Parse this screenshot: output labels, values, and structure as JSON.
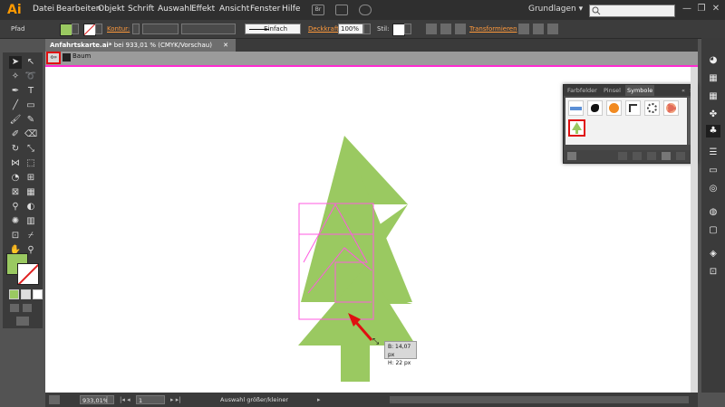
{
  "app": {
    "logo": "Ai"
  },
  "menu": [
    "Datei",
    "Bearbeiten",
    "Objekt",
    "Schrift",
    "Auswahl",
    "Effekt",
    "Ansicht",
    "Fenster",
    "Hilfe"
  ],
  "menubar": {
    "br_label": "Br",
    "workspace": "Grundlagen",
    "workspace_arrow": "▾",
    "search_icon": "search-icon"
  },
  "window_controls": {
    "minimize": "—",
    "restore": "❐",
    "close": "✕"
  },
  "control_bar": {
    "selection_type": "Pfad",
    "fill_color": "#9ac961",
    "stroke_label": "Kontur:",
    "stroke_style": "Einfach",
    "opacity_label": "Deckkraft",
    "opacity_value": "100%",
    "style_label": "Stil:",
    "transform_label": "Transformieren"
  },
  "document": {
    "tab_name": "Anfahrtskarte.ai*",
    "tab_info": "bei 933,01 % (CMYK/Vorschau)",
    "tab_close": "✕",
    "isolation_label": "Baum",
    "isolation_back_icon": "back-arrow-icon"
  },
  "panel": {
    "tabs": [
      "Farbfelder",
      "Pinsel",
      "Symbole"
    ],
    "active_tab": "Symbole",
    "collapse": "«",
    "menu": "≡",
    "symbols": [
      "blue-banner-symbol",
      "ink-splat-symbol",
      "orange-button-symbol",
      "frame-corner-symbol",
      "dotted-ring-symbol",
      "red-flower-symbol",
      "tree-symbol"
    ]
  },
  "tooltip": {
    "width": "B: 14,07 px",
    "height": "H: 22 px"
  },
  "status_bar": {
    "zoom": "933,01%",
    "page": "1",
    "mode": "Auswahl größer/kleiner"
  },
  "colors": {
    "accent_tree": "#9ac961",
    "isolation_border": "#ff2bd1",
    "highlight": "#e01010",
    "link_orange": "#ff9a3c"
  }
}
